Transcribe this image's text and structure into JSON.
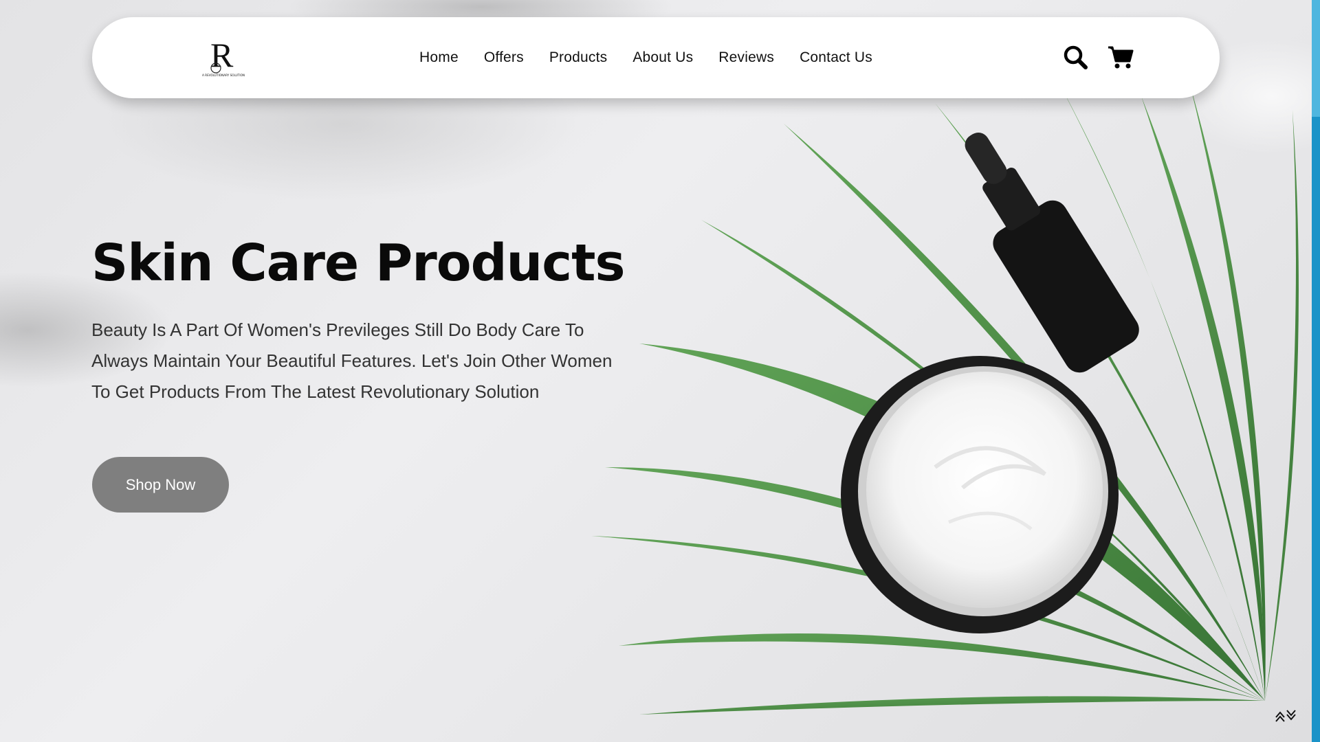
{
  "brand": {
    "logo_letter": "R",
    "tagline": "A REVOLUTIONARY SOLUTION"
  },
  "nav": {
    "links": [
      "Home",
      "Offers",
      "Products",
      "About Us",
      "Reviews",
      "Contact Us"
    ],
    "icons": [
      "search-icon",
      "cart-icon"
    ]
  },
  "hero": {
    "title": "Skin Care Products",
    "description": "Beauty Is A Part Of Women's Previleges Still Do Body Care To Always Maintain Your Beautiful Features. Let's Join Other Women To Get Products From The Latest Revolutionary Solution",
    "cta_label": "Shop Now"
  },
  "colors": {
    "cta_background": "#7f7f7f",
    "edge_accent": "#1b93c8",
    "leaf_green": "#3f8a3a"
  }
}
